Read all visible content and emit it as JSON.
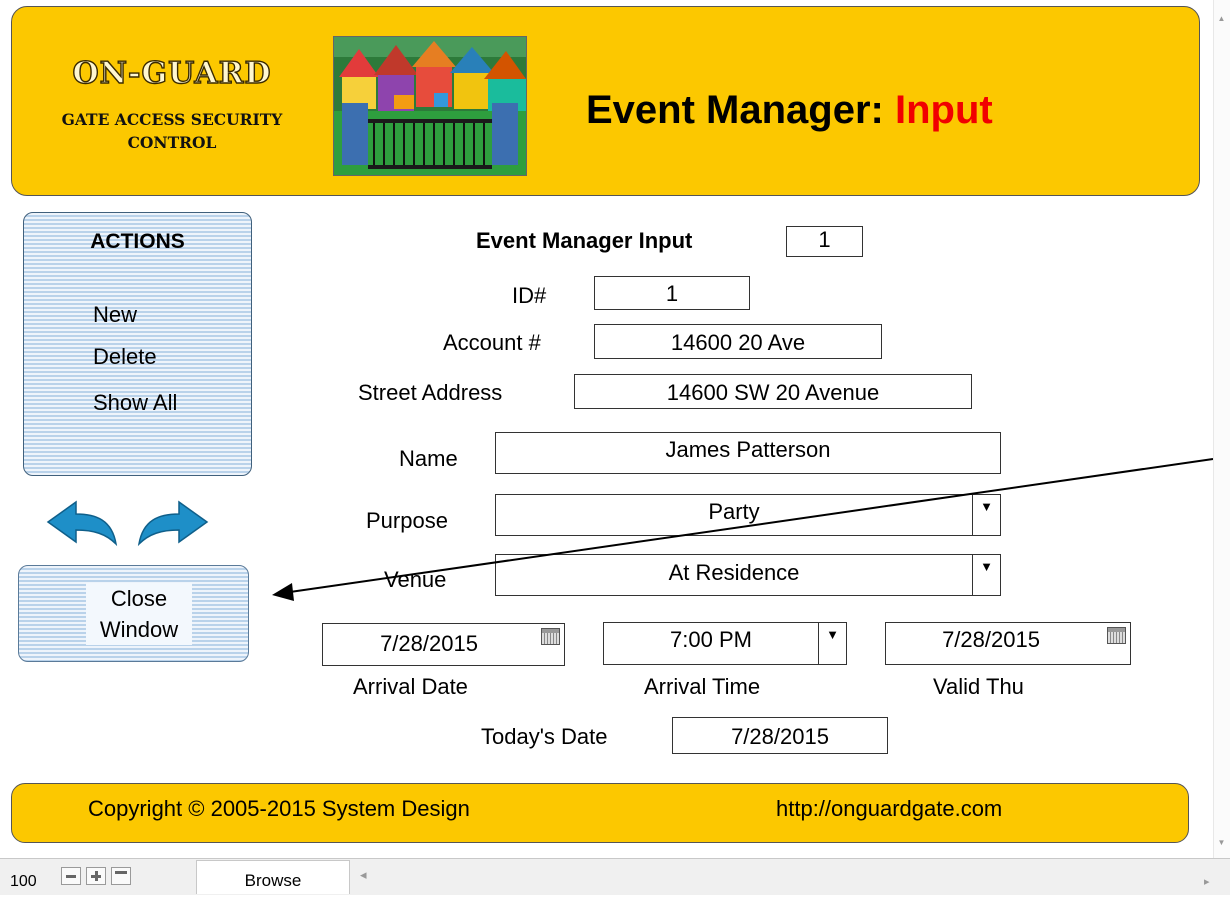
{
  "header": {
    "logo_title": "ON-GUARD",
    "logo_line1": "GATE ACCESS SECURITY",
    "logo_line2": "CONTROL",
    "title": "Event Manager: ",
    "title_highlight": "Input"
  },
  "actions": {
    "title": "ACTIONS",
    "items": [
      "New",
      "Delete",
      "Show All"
    ]
  },
  "close_button": {
    "line1": "Close",
    "line2": "Window"
  },
  "form": {
    "heading": "Event Manager Input",
    "record_number": "1",
    "id_label": "ID#",
    "id_value": "1",
    "account_label": "Account #",
    "account_value": "14600 20 Ave",
    "street_label": "Street Address",
    "street_value": "14600 SW 20 Avenue",
    "name_label": "Name",
    "name_value": "James Patterson",
    "purpose_label": "Purpose",
    "purpose_value": "Party",
    "venue_label": "Venue",
    "venue_value": "At Residence",
    "arrival_date_value": "7/28/2015",
    "arrival_date_label": "Arrival Date",
    "arrival_time_value": "7:00 PM",
    "arrival_time_label": "Arrival Time",
    "valid_thru_value": "7/28/2015",
    "valid_thru_label": "Valid Thu",
    "todays_date_label": "Today's Date",
    "todays_date_value": "7/28/2015"
  },
  "footer": {
    "copyright": "Copyright © 2005-2015 System Design",
    "url": "http://onguardgate.com"
  },
  "statusbar": {
    "zoom": "100",
    "mode": "Browse"
  },
  "colors": {
    "banner_yellow": "#fcc800",
    "title_red": "#f10000",
    "nav_arrow_blue": "#1e8fc8"
  }
}
